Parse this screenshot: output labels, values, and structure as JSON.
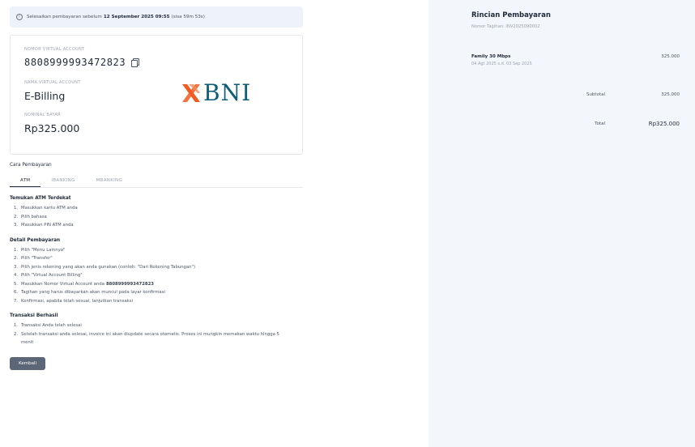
{
  "notice": {
    "prefix": "Selesaikan pembayaran sebelum",
    "deadline": "12 September 2025 09:55",
    "remaining": "(sisa 59m 53s)"
  },
  "va": {
    "number_label": "NOMOR VIRTUAL ACCOUNT",
    "number": "8808999993472823",
    "name_label": "NAMA VIRTUAL ACCOUNT",
    "name": "E-Billing",
    "amount_label": "NOMINAL BAYAR",
    "amount": "Rp325.000",
    "bank_name": "BNI"
  },
  "payment_method": {
    "title": "Cara Pembayaran",
    "tabs": [
      {
        "label": "ATM",
        "active": true
      },
      {
        "label": "IBANKING",
        "active": false
      },
      {
        "label": "MBANKING",
        "active": false
      }
    ]
  },
  "groups": [
    {
      "title": "Temukan ATM Terdekat",
      "steps": [
        {
          "n": "1.",
          "text": "Masukkan kartu ATM anda",
          "bold": ""
        },
        {
          "n": "2.",
          "text": "Pilih bahasa",
          "bold": ""
        },
        {
          "n": "3.",
          "text": "Masukkan PIN ATM anda",
          "bold": ""
        }
      ]
    },
    {
      "title": "Detail Pembayaran",
      "steps": [
        {
          "n": "1.",
          "text": "Pilih \"Menu Lainnya\"",
          "bold": ""
        },
        {
          "n": "2.",
          "text": "Pilih \"Transfer\"",
          "bold": ""
        },
        {
          "n": "3.",
          "text": "Pilih jenis rekening yang akan anda gunakan (contoh: \"Dari Rekening Tabungan\")",
          "bold": ""
        },
        {
          "n": "4.",
          "text": "Pilih \"Virtual Account Billing\"",
          "bold": ""
        },
        {
          "n": "5.",
          "text": "Masukkan Nomor Virtual Account anda",
          "bold": "8808999993472823"
        },
        {
          "n": "6.",
          "text": "Tagihan yang harus dibayarkan akan muncul pada layar konfirmasi",
          "bold": ""
        },
        {
          "n": "7.",
          "text": "Konfirmasi, apabila telah sesuai, lanjutkan transaksi",
          "bold": ""
        }
      ]
    },
    {
      "title": "Transaksi Berhasil",
      "steps": [
        {
          "n": "1.",
          "text": "Transaksi Anda telah selesai",
          "bold": ""
        },
        {
          "n": "2.",
          "text": "Setelah transaksi anda selesai, invoice ini akan diupdate secara otomatis. Proses ini mungkin memakan waktu hingga 5 menit",
          "bold": ""
        }
      ]
    }
  ],
  "back_label": "Kembali",
  "summary": {
    "title": "Rincian Pembayaran",
    "invoice": "Nomor Tagihan: INV2025090002",
    "item_name": "Family 30 Mbps",
    "item_period": "04 Agt 2025 s.d. 03 Sep 2025",
    "item_price": "325.000",
    "subtotal_label": "Subtotal",
    "subtotal_value": "325.000",
    "total_label": "Total",
    "total_value": "Rp325.000"
  },
  "colors": {
    "bni_teal": "#0d5e78",
    "bni_orange": "#f15a22",
    "panel_bg": "#f3f6fa",
    "notice_bg": "#eef3fb",
    "button_bg": "#5b6676"
  }
}
